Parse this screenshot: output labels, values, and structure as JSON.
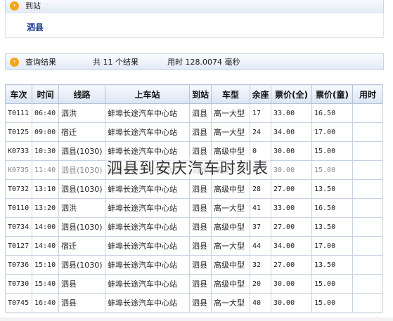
{
  "header": {
    "title": "到站",
    "destination": "泗县"
  },
  "summary": {
    "title": "查询结果",
    "count_text": "共 11 个结果",
    "time_text": "用时 128.0074 毫秒"
  },
  "table": {
    "headers": [
      "车次",
      "时间",
      "线路",
      "上车站",
      "到站",
      "车型",
      "余座",
      "票价(全)",
      "票价(童)",
      "用时"
    ],
    "rows": [
      [
        "T0111",
        "06:40",
        "泗洪",
        "蚌埠长途汽车中心站",
        "泗县",
        "高一大型",
        "17",
        "33.00",
        "16.50",
        ""
      ],
      [
        "T0125",
        "09:00",
        "宿迁",
        "蚌埠长途汽车中心站",
        "泗县",
        "高一大型",
        "24",
        "34.00",
        "17.00",
        ""
      ],
      [
        "K0733",
        "10:30",
        "泗县(1030)",
        "蚌埠长途汽车中心站",
        "泗县",
        "高级中型",
        "0",
        "30.00",
        "15.00",
        ""
      ],
      [
        "K0735",
        "11:40",
        "泗县(1030)",
        "蚌埠长途汽车中心站",
        "泗县",
        "高级中型",
        "0",
        "30.00",
        "15.00",
        ""
      ],
      [
        "T0732",
        "13:10",
        "泗县(1030)",
        "蚌埠长途汽车中心站",
        "泗县",
        "高级中型",
        "28",
        "27.00",
        "13.50",
        ""
      ],
      [
        "T0110",
        "13:20",
        "泗洪",
        "蚌埠长途汽车中心站",
        "泗县",
        "高一大型",
        "41",
        "33.00",
        "16.50",
        ""
      ],
      [
        "T0734",
        "14:00",
        "泗县(1030)",
        "蚌埠长途汽车中心站",
        "泗县",
        "高级中型",
        "37",
        "27.00",
        "13.50",
        ""
      ],
      [
        "T0127",
        "14:40",
        "宿迁",
        "蚌埠长途汽车中心站",
        "泗县",
        "高一大型",
        "44",
        "34.00",
        "17.00",
        ""
      ],
      [
        "T0736",
        "15:10",
        "泗县(1030)",
        "蚌埠长途汽车中心站",
        "泗县",
        "高级中型",
        "32",
        "27.00",
        "13.50",
        ""
      ],
      [
        "T0730",
        "15:40",
        "泗县",
        "蚌埠长途汽车中心站",
        "泗县",
        "高级中型",
        "20",
        "30.00",
        "15.00",
        ""
      ],
      [
        "T0745",
        "16:40",
        "泗县",
        "蚌埠长途汽车中心站",
        "泗县",
        "高一大型",
        "40",
        "30.00",
        "15.00",
        ""
      ]
    ]
  },
  "overlay_text": "泗县到安庆汽车时刻表",
  "colors": {
    "accent_icon": "#f2a51a",
    "header_bg": "#dbe5f3",
    "destination_text": "#1a3a8c"
  }
}
